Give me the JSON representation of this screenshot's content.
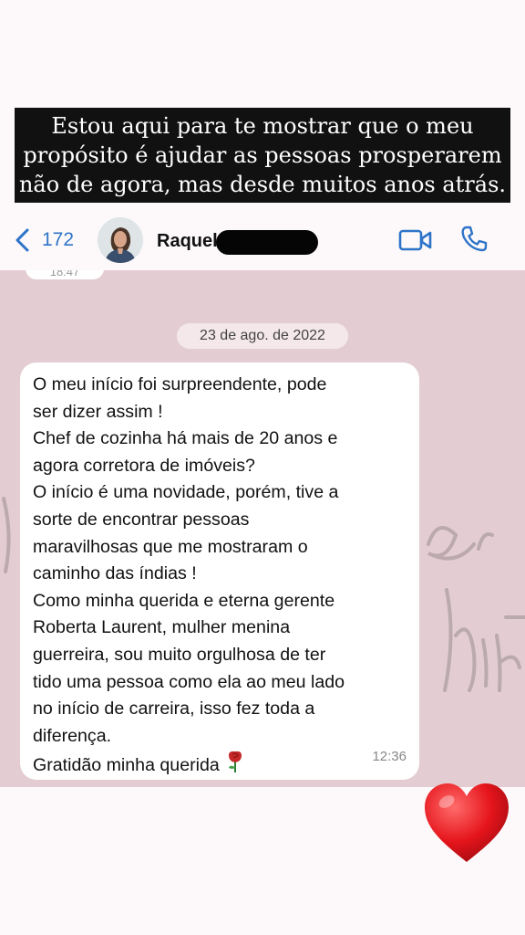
{
  "caption": {
    "lines": [
      "Estou aqui para te mostrar que o meu",
      "propósito é ajudar as pessoas prosperarem",
      "não de agora, mas desde muitos anos atrás."
    ]
  },
  "header": {
    "back_count": "172",
    "contact_name": "Raquel",
    "accent_color": "#2d74c8"
  },
  "chat": {
    "previous_time": "18:47",
    "date_divider": "23 de ago. de 2022",
    "message": {
      "lines": [
        "O meu início foi surpreendente, pode",
        "ser dizer assim !",
        "Chef de cozinha há mais de 20 anos e",
        "agora corretora de imóveis?",
        "O início é uma novidade, porém, tive a",
        "sorte de encontrar  pessoas",
        "maravilhosas que me mostraram o",
        "caminho das índias !",
        "Como minha querida e eterna gerente",
        "Roberta Laurent, mulher menina",
        "guerreira, sou muito orgulhosa de ter",
        "tido uma pessoa como ela ao  meu lado",
        "no  início de carreira, isso fez toda a",
        "diferença.",
        "Gratidão minha querida"
      ],
      "emoji": "rose",
      "time": "12:36"
    },
    "background_color": "#e3cdd2"
  },
  "sticker": "heart"
}
